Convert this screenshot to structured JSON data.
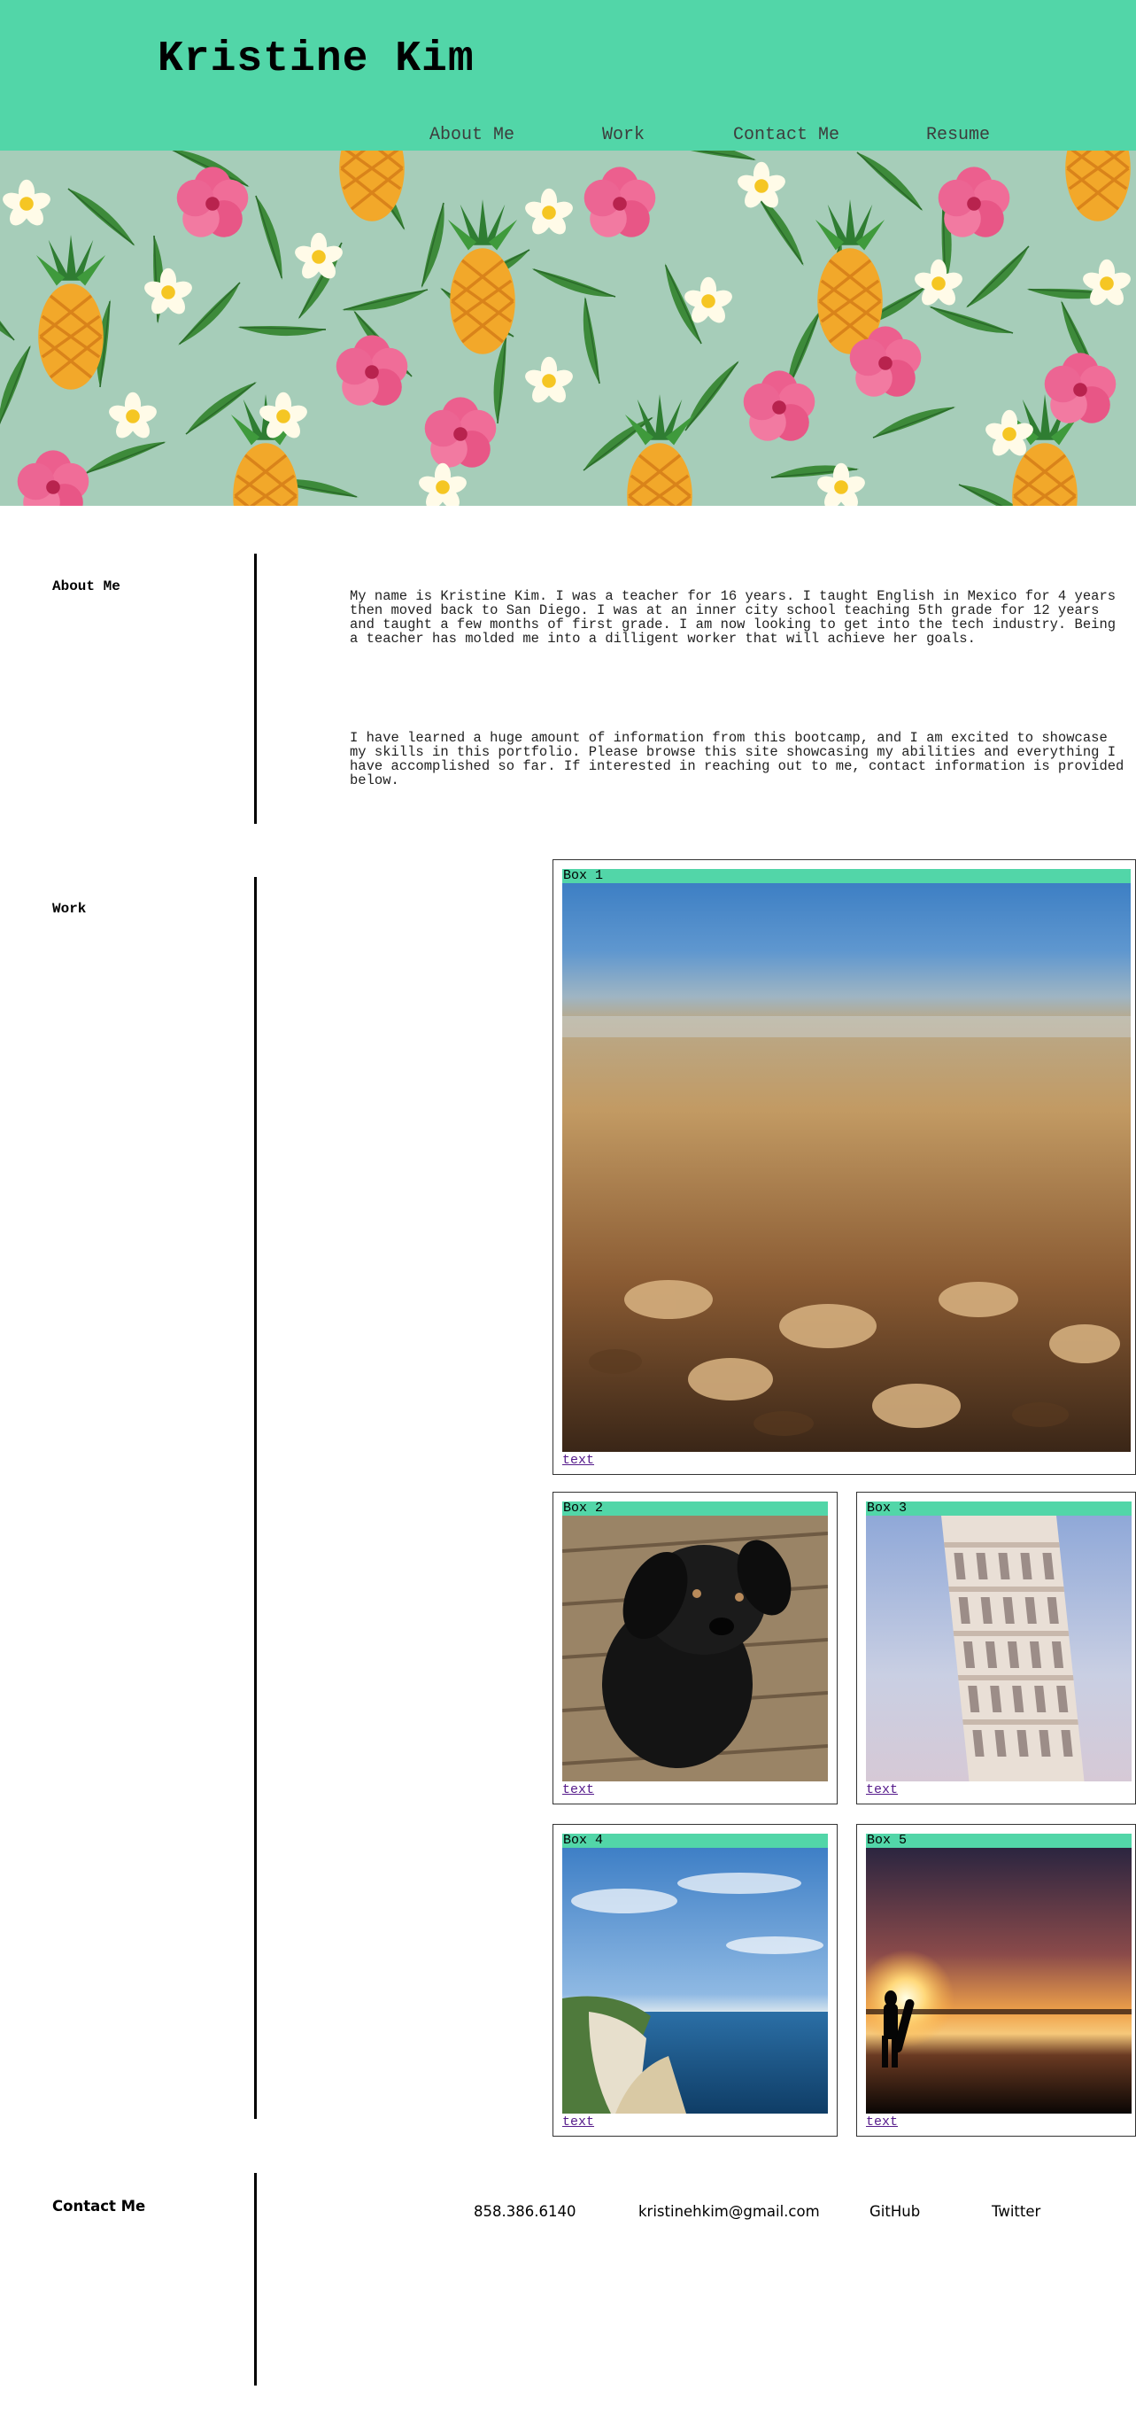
{
  "header": {
    "title": "Kristine Kim",
    "nav": [
      {
        "label": "About Me"
      },
      {
        "label": "Work"
      },
      {
        "label": "Contact Me"
      },
      {
        "label": "Resume"
      }
    ],
    "bg_color": "#52d6a8"
  },
  "banner": {
    "pattern_icons": [
      "pineapple-icon",
      "hibiscus-icon",
      "plumeria-icon",
      "palm-leaf-icon"
    ]
  },
  "about": {
    "label": "About Me",
    "paragraphs": [
      "My name is Kristine Kim. I was a teacher for 16 years. I taught English in Mexico for 4 years then moved back to San Diego. I was at an inner city school teaching 5th grade for 12 years and taught a few months of first grade. I am now looking to get into the tech industry. Being a teacher has molded me into a dilligent worker that will achieve her goals.",
      "I have learned a huge amount of information from this bootcamp, and I am excited to showcase my skills in this portfolio. Please browse this site showcasing my abilities and everything I have accomplished so far. If interested in reaching out to me, contact information is provided below."
    ]
  },
  "work": {
    "label": "Work",
    "boxes": [
      {
        "label": "Box 1",
        "link": "text",
        "image": "beach-shells-photo"
      },
      {
        "label": "Box 2",
        "link": "text",
        "image": "black-puppy-photo"
      },
      {
        "label": "Box 3",
        "link": "text",
        "image": "leaning-tower-photo"
      },
      {
        "label": "Box 4",
        "link": "text",
        "image": "coastline-photo"
      },
      {
        "label": "Box 5",
        "link": "text",
        "image": "surfer-sunset-photo"
      }
    ]
  },
  "contact": {
    "label": "Contact Me",
    "phone": "858.386.6140",
    "email": "kristinehkim@gmail.com",
    "github": "GitHub",
    "twitter": "Twitter"
  }
}
